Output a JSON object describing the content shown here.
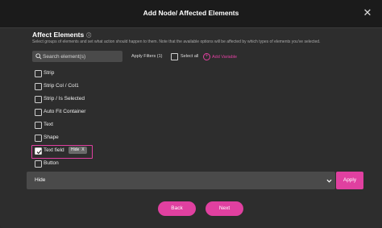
{
  "modal": {
    "title": "Add Node/ Affected Elements",
    "close_icon": "close-icon"
  },
  "section": {
    "title": "Affect Elements",
    "info_icon": "info-icon",
    "description": "Select groups of elements and set what action should happen to them. Note that the available options will be affected by which types of elements you've selected."
  },
  "toolbar": {
    "search_placeholder": "Search element(s)",
    "apply_filters_label": "Apply Filters (1)",
    "select_all_label": "Select all",
    "add_variable_label": "Add Variable"
  },
  "elements": [
    {
      "label": "Strip",
      "checked": false
    },
    {
      "label": "Strip Col / Col1",
      "checked": false
    },
    {
      "label": "Strip / Is Selected",
      "checked": false
    },
    {
      "label": "Auto Fit Container",
      "checked": false
    },
    {
      "label": "Text",
      "checked": false
    },
    {
      "label": "Shape",
      "checked": false
    },
    {
      "label": "Text field",
      "checked": true,
      "tag": "Hide",
      "tag_remove": "X"
    },
    {
      "label": "Button",
      "checked": false
    }
  ],
  "action": {
    "selected_value": "Hide",
    "apply_label": "Apply"
  },
  "footer": {
    "back_label": "Back",
    "next_label": "Next"
  },
  "colors": {
    "accent": "#e040a0",
    "modal_bg": "#2d2d2d",
    "header_bg": "#1b1b1b",
    "field_bg": "#4a4a4a"
  }
}
